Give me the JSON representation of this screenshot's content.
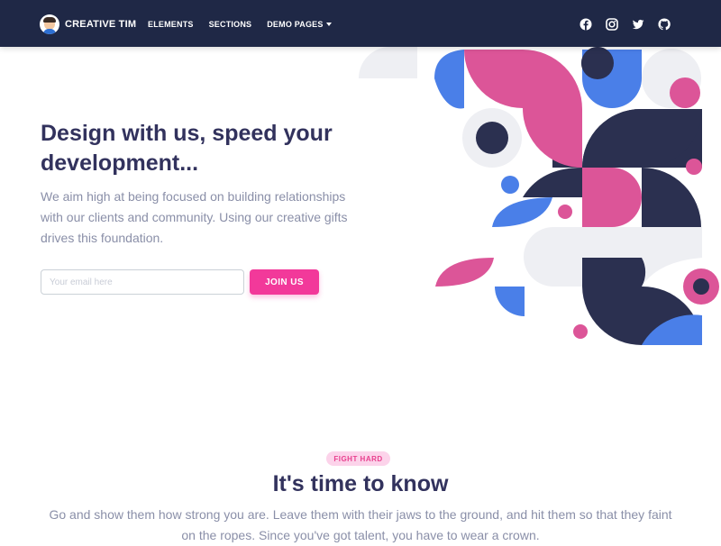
{
  "navbar": {
    "brand": {
      "name": "CREATIVE TIM",
      "logo_icon": "avatar-icon"
    },
    "links": [
      {
        "label": "ELEMENTS"
      },
      {
        "label": "SECTIONS"
      },
      {
        "label": "DEMO PAGES",
        "dropdown": true
      }
    ],
    "social_icons": [
      "facebook-icon",
      "instagram-icon",
      "twitter-icon",
      "github-icon"
    ]
  },
  "hero": {
    "title": "Design with us, speed your development...",
    "text": "We aim high at being focused on building relationships with our clients and community. Using our creative gifts drives this foundation.",
    "email_placeholder": "Your email here",
    "join_label": "JOIN US"
  },
  "section": {
    "badge": "FIGHT HARD",
    "title": "It's time to know",
    "text": "Go and show them how strong you are. Leave them with their jaws to the ground, and hit them so that they faint on the ropes. Since you've got talent, you have to wear a crown."
  },
  "colors": {
    "navy": "#1f2846",
    "pink": "#f2399a",
    "art_navy": "#2b3050",
    "art_pink": "#dc5598",
    "art_blue": "#4a7fe8",
    "art_gray": "#eeeff3"
  }
}
